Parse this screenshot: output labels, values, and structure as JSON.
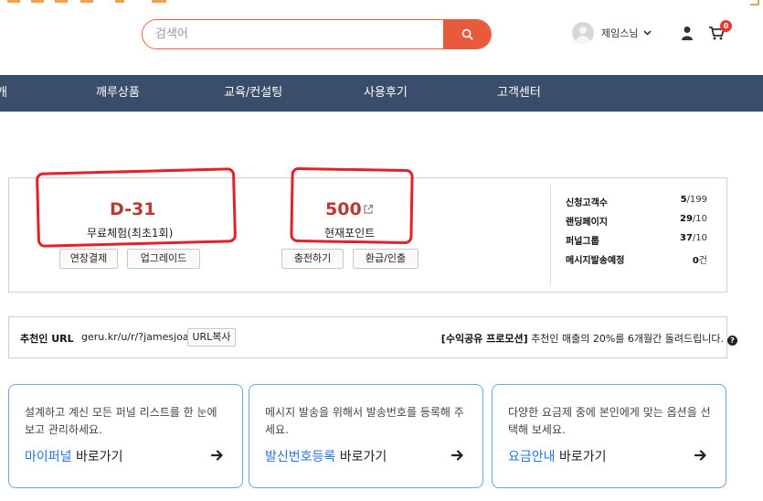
{
  "header": {
    "search_placeholder": "검색어",
    "user_name": "제임스님",
    "cart_count": "0"
  },
  "nav": {
    "items": [
      {
        "label": "개"
      },
      {
        "label": "깨루상품"
      },
      {
        "label": "교육/컨설팅"
      },
      {
        "label": "사용후기"
      },
      {
        "label": "고객센터"
      }
    ]
  },
  "stats": {
    "dday": "D-31",
    "dday_label": "무료체험(최초1회)",
    "extend_button": "연장결제",
    "upgrade_button": "업그레이드",
    "points": "500",
    "points_label": "현재포인트",
    "charge_button": "충전하기",
    "refund_button": "환급/인출",
    "rows": [
      {
        "label": "신청고객수",
        "value": "5",
        "suffix": "/199"
      },
      {
        "label": "랜딩페이지",
        "value": "29",
        "suffix": "/10"
      },
      {
        "label": "퍼널그룹",
        "value": "37",
        "suffix": "/10"
      },
      {
        "label": "메시지발송예정",
        "value": "0",
        "suffix": "건"
      }
    ]
  },
  "referral": {
    "label": "추천인 URL",
    "url": "geru.kr/u/r/?jamesjoa",
    "copy_button": "URL복사",
    "promo_title": "[수익공유 프로모션]",
    "promo_text": " 추천인 매출의 20%를 6개월간 돌려드립니다."
  },
  "cards": [
    {
      "desc": "설계하고 계신 모든 퍼널 리스트를 한 눈에 보고 관리하세요.",
      "highlight": "마이퍼널",
      "rest": " 바로가기"
    },
    {
      "desc": "메시지 발송을 위해서 발송번호를 등록해 주세요.",
      "highlight": "발신번호등록",
      "rest": " 바로가기"
    },
    {
      "desc": "다양한 요금제 중에 본인에게 맞는 옵션을 선택해 보세요.",
      "highlight": "요금안내",
      "rest": " 바로가기"
    }
  ],
  "colors": {
    "accent": "#e75a3c",
    "nav_bg": "#3a4d6b",
    "value_red": "#b83a2f",
    "link_blue": "#2a74d6",
    "annotation": "#e0232b"
  }
}
